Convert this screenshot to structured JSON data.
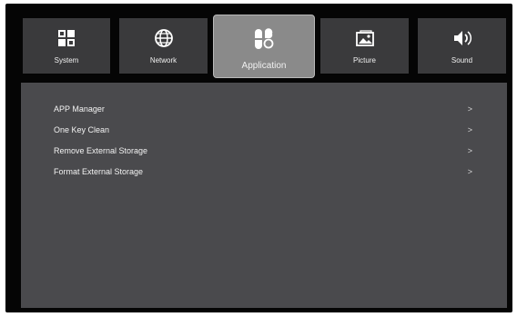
{
  "tabs": [
    {
      "label": "System",
      "icon": "system-grid-icon"
    },
    {
      "label": "Network",
      "icon": "globe-icon"
    },
    {
      "label": "Application",
      "icon": "app-flower-icon",
      "active": true
    },
    {
      "label": "Picture",
      "icon": "picture-icon"
    },
    {
      "label": "Sound",
      "icon": "speaker-icon"
    }
  ],
  "menu": {
    "items": [
      {
        "label": "APP Manager",
        "chevron": ">"
      },
      {
        "label": "One Key Clean",
        "chevron": ">"
      },
      {
        "label": "Remove External Storage",
        "chevron": ">"
      },
      {
        "label": "Format External Storage",
        "chevron": ">"
      }
    ]
  },
  "colors": {
    "screen_bg": "#050505",
    "tab_bg": "#3a3a3c",
    "tab_active_bg": "#8a8a8a",
    "panel_bg": "#4a4a4d",
    "text": "#f2f2f2"
  }
}
